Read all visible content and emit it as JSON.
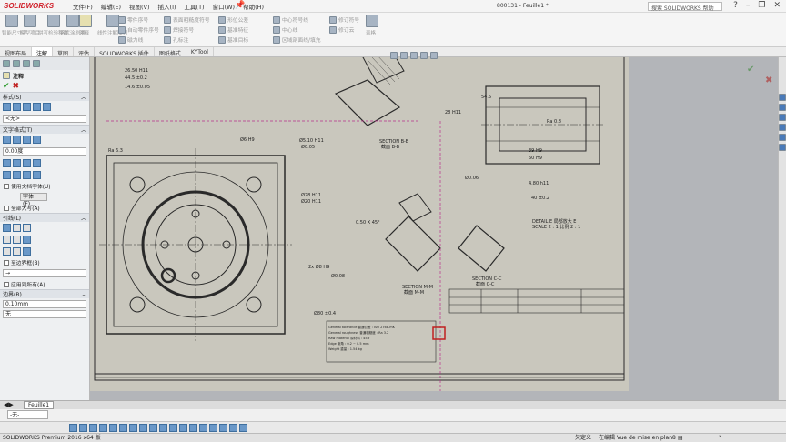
{
  "app": {
    "logo": "SOLIDWORKS",
    "doc_title": "800131 - Feuille1 *",
    "search_placeholder": "搜索 SOLIDWORKS 帮助"
  },
  "menu": [
    "文件(F)",
    "编辑(E)",
    "视图(V)",
    "插入(I)",
    "工具(T)",
    "窗口(W)",
    "帮助(H)"
  ],
  "ribbon": {
    "smart_dim": "智能尺寸",
    "model_items": "模型项目",
    "spell": "拼写检验程序",
    "format_painter": "格式涂刷器",
    "note": "注释",
    "linear_pattern": "线性注解阵列",
    "balloon": "零件序号",
    "auto_balloon": "自动零件序号",
    "magnetic_line": "磁力线",
    "surface_finish": "表面粗糙度符号",
    "weld": "焊接符号",
    "hole_callout": "孔标注",
    "gtol": "形位公差",
    "datum": "基准特征",
    "datum_target": "基准目标",
    "center_mark": "中心符号线",
    "centerline": "中心线",
    "area_hatch": "区域剖面线/填充",
    "revision_symbol": "修订符号",
    "revision_cloud": "修订云",
    "tables": "表格"
  },
  "tabs": [
    "视图布局",
    "注解",
    "草图",
    "评估",
    "SOLIDWORKS 插件",
    "图纸格式",
    "KYTool"
  ],
  "active_tab": "注解",
  "panel": {
    "title": "注释",
    "style_label": "样式(S)",
    "style_value": "<无>",
    "text_format_label": "文字格式(T)",
    "angle_value": "0.00度",
    "use_doc_font": "使用文档字体(U)",
    "font_btn": "字体(F)...",
    "all_caps": "全部大写(A)",
    "leader_label": "引线(L)",
    "to_boundary": "至边界框(B)",
    "apply_all": "应用到所有(A)",
    "border_label": "边界(B)",
    "border_value": "0.10mm",
    "border_style": "无"
  },
  "sheet_tab": "Feuille1",
  "layer_combo": "-无-",
  "status": {
    "product": "SOLIDWORKS Premium 2016 x64 版",
    "custom": "欠定义",
    "editing": "在编辑 Vue de mise en plan8"
  },
  "drawing": {
    "section_bb": "SECTION B-B",
    "section_bb_cn": "截面 B-B",
    "section_mm": "SECTION M-M",
    "section_mm_cn": "截面 M-M",
    "section_cc": "SECTION C-C",
    "section_cc_cn": "截面 C-C",
    "detail_e": "DETAIL E 局部放大 E",
    "detail_scale": "SCALE 2 : 1  比例 2 : 1",
    "ra": "Ra 6.3",
    "dims": [
      "26.50 H11",
      "44.5 ±0.2",
      "14.6 ±0.05",
      "28 H11",
      "54.5",
      "39 H9",
      "60 H9",
      "4.80 h11",
      "40 ±0.2",
      "Ø5.10 H11",
      "Ø6 H9",
      "Ø28 H11",
      "Ø20 H11",
      "Ø0.05",
      "Ø0.06",
      "Ø0.08",
      "Ø80 ±0.4",
      "2x Ø8 H9",
      "0.50 X 45°",
      "Ra 0.8"
    ],
    "notes": [
      "General tolerance 普通公差 : ISO 2768-mK",
      "General roughness 普通粗糙度 : Ra 3.2",
      "Raw material 原材料 : 45#",
      "Edge 倒角 : 0.2 ~ 0.5 mm",
      "Weight 重量 : 1.54 kg"
    ]
  }
}
